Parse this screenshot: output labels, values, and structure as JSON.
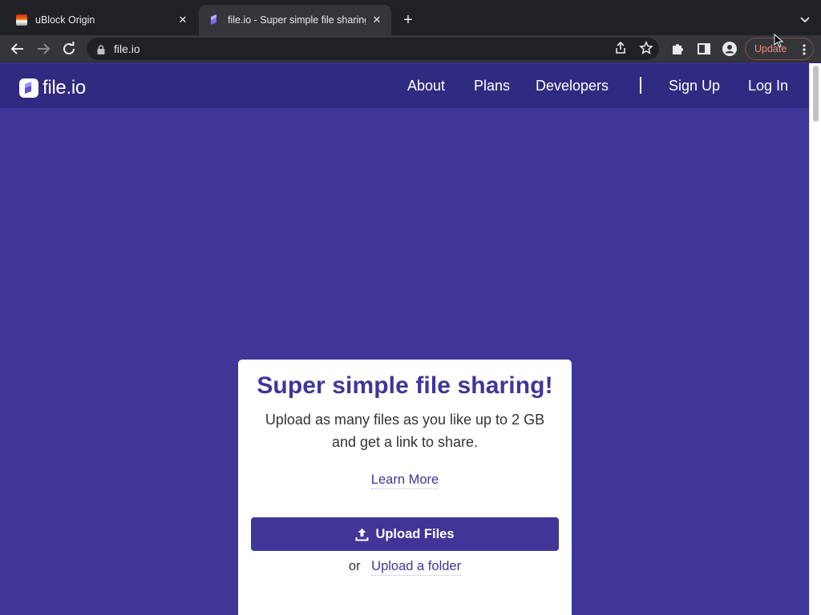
{
  "browser": {
    "tabs": [
      {
        "title": "uBlock Origin",
        "active": false
      },
      {
        "title": "file.io - Super simple file sharing!",
        "active": true
      }
    ],
    "new_tab_icon": "plus-icon",
    "address": "file.io",
    "update_label": "Update"
  },
  "site": {
    "logo_text": "file.io",
    "nav": {
      "about": "About",
      "plans": "Plans",
      "developers": "Developers",
      "sign_up": "Sign Up",
      "log_in": "Log In"
    }
  },
  "card": {
    "title": "Super simple file sharing!",
    "subtitle_line1": "Upload as many files as you like up to 2 GB",
    "subtitle_line2": "and get a link to share.",
    "learn_more": "Learn More",
    "upload_button": "Upload Files",
    "or_text": "or",
    "upload_folder": "Upload a folder"
  },
  "colors": {
    "brand": "#3f3697",
    "header": "#302a80",
    "chrome_dark": "#202124",
    "chrome_toolbar": "#35363a",
    "update_accent": "#f28b82"
  }
}
